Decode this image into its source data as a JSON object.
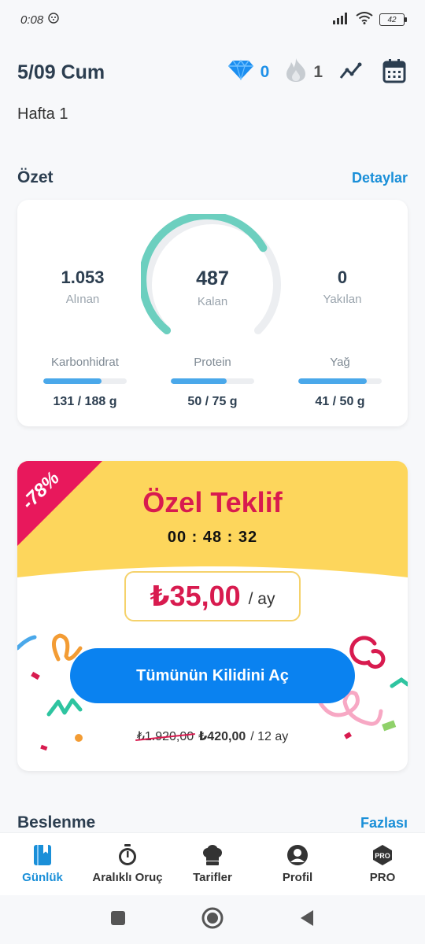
{
  "status_bar": {
    "time": "0:08",
    "battery": "42"
  },
  "header": {
    "date": "5/09 Cum",
    "gems": "0",
    "streak": "1"
  },
  "week_label": "Hafta 1",
  "summary": {
    "title": "Özet",
    "link": "Detaylar",
    "eaten": {
      "value": "1.053",
      "label": "Alınan"
    },
    "remaining": {
      "value": "487",
      "label": "Kalan"
    },
    "burned": {
      "value": "0",
      "label": "Yakılan"
    },
    "macros": [
      {
        "label": "Karbonhidrat",
        "value": "131 / 188 g",
        "progress": 0.7
      },
      {
        "label": "Protein",
        "value": "50 / 75 g",
        "progress": 0.67
      },
      {
        "label": "Yağ",
        "value": "41 / 50 g",
        "progress": 0.82
      }
    ]
  },
  "offer": {
    "badge": "-78%",
    "title": "Özel Teklif",
    "timer": "00 : 48 : 32",
    "price": "₺35,00",
    "per": "/ ay",
    "button": "Tümünün Kilidini Aç",
    "old_price": "₺1.920,00",
    "new_price": "₺420,00",
    "period": "/ 12 ay"
  },
  "nutrition": {
    "title": "Beslenme",
    "link": "Fazlası"
  },
  "nav": {
    "items": [
      {
        "label": "Günlük"
      },
      {
        "label": "Aralıklı Oruç"
      },
      {
        "label": "Tarifler"
      },
      {
        "label": "Profil"
      },
      {
        "label": "PRO",
        "icon_text": "PRO"
      }
    ]
  },
  "colors": {
    "accent": "#1a8fd8",
    "offer_red": "#d81b4f",
    "offer_yellow": "#fdd65c",
    "gauge": "#6ccfbf"
  }
}
